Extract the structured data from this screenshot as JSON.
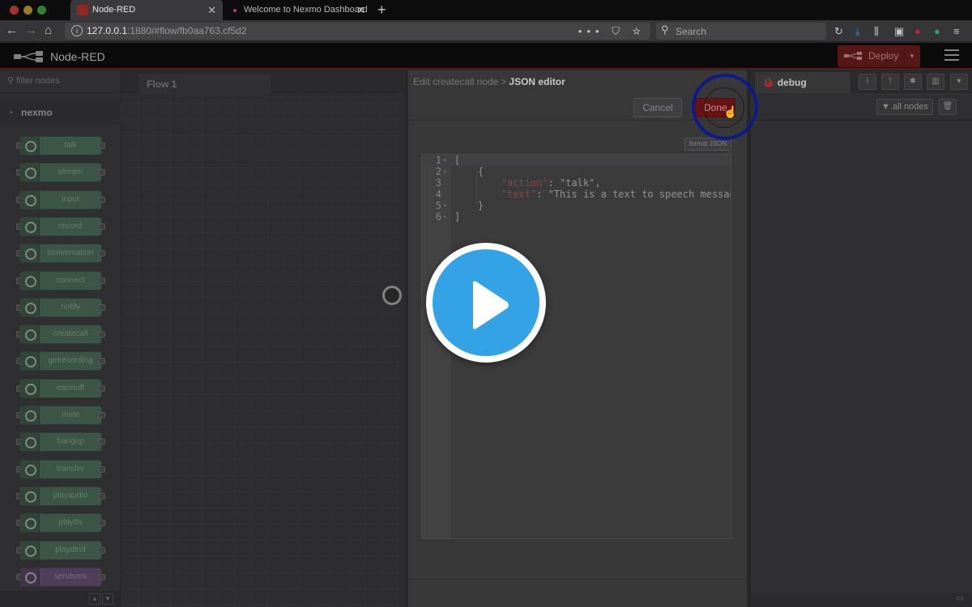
{
  "browser": {
    "tabs": [
      {
        "title": "Node-RED",
        "active": true
      },
      {
        "title": "Welcome to Nexmo Dashboard",
        "active": false
      }
    ],
    "url": {
      "host": "127.0.0.1",
      "path": ":1880/#flow/fb0aa763.cf5d2"
    },
    "search_placeholder": "Search"
  },
  "app": {
    "title": "Node-RED",
    "deploy_label": "Deploy"
  },
  "palette": {
    "filter_placeholder": "filter nodes",
    "category": "nexmo",
    "nodes": [
      "talk",
      "stream",
      "input",
      "record",
      "conversation",
      "connect",
      "notify",
      "createcall",
      "getrecording",
      "earmuff",
      "mute",
      "hangup",
      "transfer",
      "playaudio",
      "playtts",
      "playdtmf",
      "sendsms"
    ]
  },
  "workspace": {
    "tab_label": "Flow 1"
  },
  "editor": {
    "breadcrumb_parent": "Edit createcall node",
    "breadcrumb_sep": ">",
    "breadcrumb_current": "JSON editor",
    "cancel_label": "Cancel",
    "done_label": "Done",
    "format_label": "format JSON",
    "lines": [
      {
        "n": "1",
        "fold": true,
        "text": "["
      },
      {
        "n": "2",
        "fold": true,
        "text": "    {"
      },
      {
        "n": "3",
        "fold": false,
        "key": "\"action\"",
        "value": ": \"talk\","
      },
      {
        "n": "4",
        "fold": false,
        "key": "\"text\"",
        "value": ": \"This is a text to speech message"
      },
      {
        "n": "5",
        "fold": true,
        "text": "    }"
      },
      {
        "n": "6",
        "fold": true,
        "text": "]"
      }
    ]
  },
  "sidebar": {
    "tab_label": "debug",
    "filter_label": "all nodes"
  },
  "colors": {
    "play_button": "#33a3e6",
    "click_highlight": "#0c1a8c",
    "node_red_accent": "#8f0000"
  }
}
